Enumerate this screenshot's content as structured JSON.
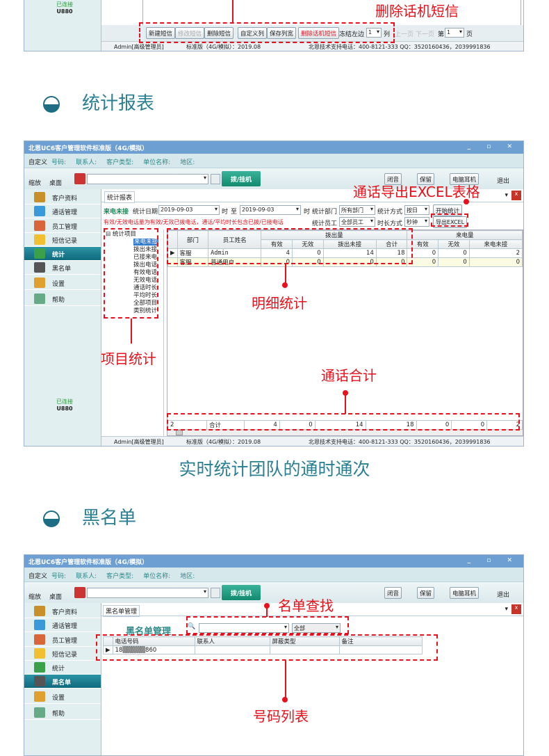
{
  "top_fragment": {
    "device_status": "已连接",
    "device_model": "U880",
    "toolbar": [
      "新建短信",
      "修改短信",
      "删除短信",
      "自定义列",
      "保存列宽",
      "删除话机短信"
    ],
    "freeze_label": "冻结左边",
    "freeze_value": "1",
    "freeze_unit": "列",
    "prev_page": "上一页",
    "next_page": "下一页",
    "page_prefix": "第",
    "page_value": "1",
    "page_suffix": "页",
    "annotation": "删除话机短信"
  },
  "status_bar": {
    "user": "Admin[高级管理员]",
    "version": "标准版（4G/模拟）：2019.08",
    "support": "北恩技术支持电话：400-8121-333  QQ：3520160436，2039991836"
  },
  "app": {
    "title": "北恩UC6客户管理软件标准版（4G/模拟）",
    "filter": [
      "自定义",
      "号码:",
      "联系人:",
      "客户类型:",
      "单位名称:",
      "地区:"
    ],
    "zoom_label": "缩放",
    "desktop_label": "桌面",
    "dial_button": "拨/挂机",
    "mute": "闭音",
    "hold": "保留",
    "headset": "电脑耳机",
    "exit": "退出",
    "sidebar": [
      "客户资料",
      "通话管理",
      "员工管理",
      "短信记录",
      "统计",
      "黑名单",
      "设置",
      "帮助"
    ],
    "device_status": "已连接",
    "device_model": "U880"
  },
  "section1": {
    "heading": "统计报表",
    "caption": "实时统计团队的通时通次"
  },
  "stats": {
    "tab": "统计报表",
    "mode": "来电未接",
    "date_label": "统计日期",
    "date_from": "2019-09-03",
    "time_label": "时",
    "to_label": "至",
    "date_to": "2019-09-03",
    "dept_label": "统计部门",
    "dept_value": "所有部门",
    "method_label": "统计方式",
    "method_value": "按日",
    "start_button": "开始统计",
    "note": "有效/无效电话量为有效/无效已拨电话，通话/平均时长包含已拨/已接电话",
    "staff_label": "统计员工",
    "staff_value": "全部员工",
    "duration_label": "时长方式",
    "duration_value": "秒钟",
    "export_button": "导出EXCEL",
    "tree_root": "统计项目",
    "tree": [
      "来电未接",
      "拨出未接",
      "已接来电",
      "拨出电话",
      "有效电话",
      "无效电话",
      "通话时长",
      "平均时长",
      "全部项目",
      "类别统计"
    ],
    "headers": {
      "dept": "部门",
      "name": "员工姓名",
      "out_group": "拨出量",
      "in_group": "来电量",
      "out": [
        "有效",
        "无效",
        "拨出未接",
        "合计"
      ],
      "in": [
        "有效",
        "无效",
        "来电未接"
      ]
    },
    "rows": [
      {
        "dept": "客服",
        "name": "Admin",
        "values": [
          "4",
          "0",
          "14",
          "18",
          "0",
          "0",
          "2"
        ]
      },
      {
        "dept": "客服",
        "name": "普通用户",
        "values": [
          "0",
          "0",
          "0",
          "0",
          "0",
          "0",
          "0"
        ]
      }
    ],
    "total": {
      "count": "2",
      "label": "合计",
      "values": [
        "4",
        "0",
        "14",
        "18",
        "0",
        "0",
        "2"
      ]
    },
    "annotations": {
      "export": "通话导出EXCEL表格",
      "detail": "明细统计",
      "items": "项目统计",
      "total": "通话合计"
    }
  },
  "section2": {
    "heading": "黑名单"
  },
  "blacklist": {
    "tab": "黑名单管理",
    "label": "黑名单管理",
    "search_placeholder": "",
    "filter_value": "全部",
    "headers": [
      "电话号码",
      "联系人",
      "屏蔽类型",
      "备注"
    ],
    "rows": [
      {
        "phone": "18▒▒▒▒▒860",
        "contact": "",
        "type": "",
        "note": ""
      }
    ],
    "annotations": {
      "search": "名单查找",
      "list": "号码列表"
    }
  }
}
